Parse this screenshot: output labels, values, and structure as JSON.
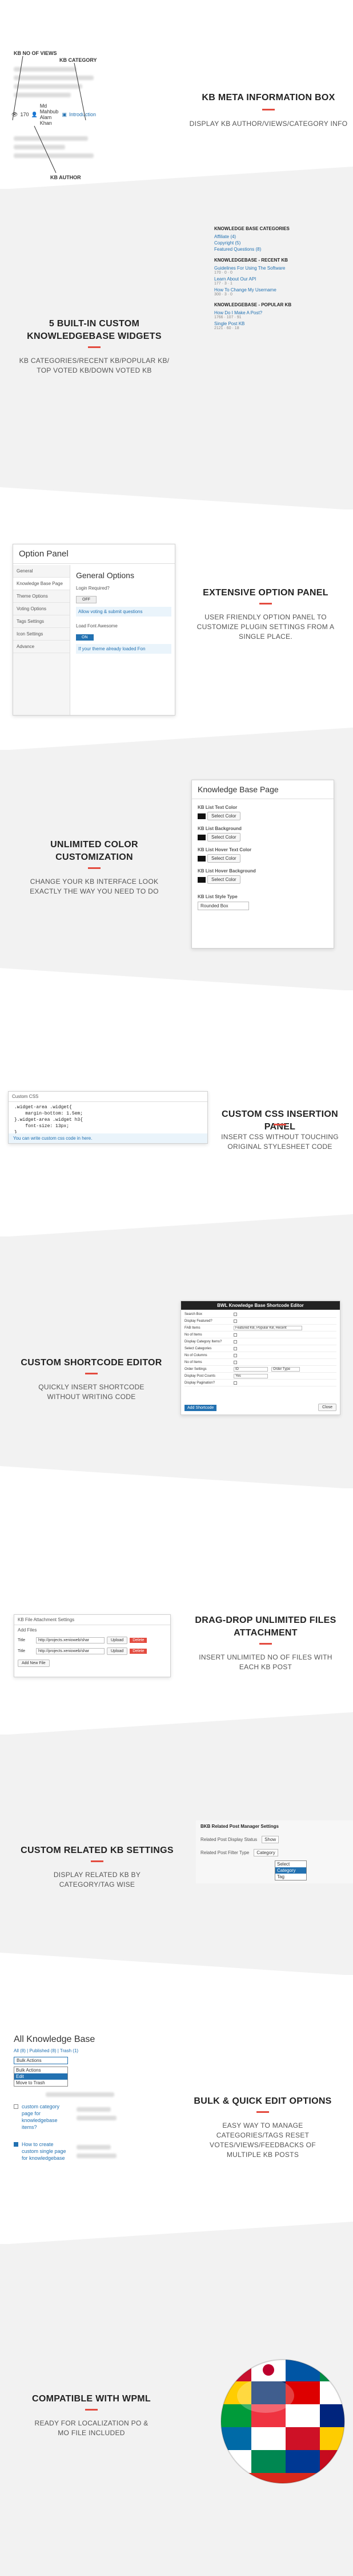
{
  "sections": {
    "meta": {
      "title": "KB META INFORMATION BOX",
      "desc": "DISPLAY KB AUTHOR/VIEWS/CATEGORY INFO",
      "callouts": {
        "views": "KB NO OF VIEWS",
        "category": "KB CATEGORY",
        "author": "KB AUTHOR"
      },
      "info_row": {
        "views": "170",
        "author": "Md Mahbub Alam Khan",
        "category": "Introduction"
      }
    },
    "widgets": {
      "title": "5 BUILT-IN CUSTOM KNOWLEDGEBASE WIDGETS",
      "desc": "KB CATEGORIES/RECENT KB/POPULAR KB/ TOP VOTED KB/DOWN VOTED KB",
      "panel": {
        "cat_heading": "KNOWLEDGE BASE CATEGORIES",
        "cat_items": [
          "Affiliate (4)",
          "Copyright (5)",
          "Featured Questions (8)"
        ],
        "recent_heading": "KNOWLEDGEBASE - RECENT KB",
        "recent_items": [
          {
            "title": "Guidelines For Using The Software",
            "meta": "170 · 0 · 0"
          },
          {
            "title": "Learn About Our API",
            "meta": "177 · 3 · 1"
          },
          {
            "title": "How To Change My Username",
            "meta": "300 · 3 · 0"
          }
        ],
        "popular_heading": "KNOWLEDGEBASE - POPULAR KB",
        "popular_items": [
          {
            "title": "How Do I Make A Post?",
            "meta": "1766 · 107 · 91"
          },
          {
            "title": "Single Post KB",
            "meta": "2121 · 60 · 18"
          }
        ]
      }
    },
    "options": {
      "title": "EXTENSIVE OPTION PANEL",
      "desc": "USER FRIENDLY OPTION PANEL TO CUSTOMIZE PLUGIN SETTINGS FROM A SINGLE PLACE.",
      "panel": {
        "header": "Option Panel",
        "menu": [
          "General",
          "Knowledge Base Page",
          "Theme Options",
          "Voting Options",
          "Tags Settings",
          "Icon Settings",
          "Advance"
        ],
        "main_title": "General Options",
        "login_label": "Login Required?",
        "login_toggle": "OFF",
        "login_hint": "Allow voting & submit questions",
        "load_label": "Load Font Awesome",
        "load_toggle": "ON",
        "load_hint": "If your theme already loaded Fon"
      }
    },
    "colors": {
      "title": "UNLIMITED COLOR CUSTOMIZATION",
      "desc": "CHANGE YOUR KB INTERFACE LOOK EXACTLY THE WAY YOU NEED TO DO",
      "panel": {
        "header": "Knowledge Base Page",
        "fields": [
          {
            "label": "KB List Text Color",
            "button": "Select Color"
          },
          {
            "label": "KB List Background",
            "button": "Select Color"
          },
          {
            "label": "KB List Hover Text Color",
            "button": "Select Color"
          },
          {
            "label": "KB List Hover Background",
            "button": "Select Color"
          }
        ],
        "style_label": "KB List Style Type",
        "style_value": "Rounded Box"
      }
    },
    "css": {
      "title": "CUSTOM CSS INSERTION PANEL",
      "desc": "INSERT CSS WITHOUT TOUCHING ORIGINAL STYLESHEET CODE",
      "panel": {
        "header": "Custom CSS",
        "lines": [
          ".widget-area .widget{",
          "    margin-bottom: 1.5em;",
          "}.widget-area .widget h3{",
          "    font-size: 13px;",
          "}"
        ],
        "hint": "You can write custom css code in here."
      }
    },
    "shortcode": {
      "title": "CUSTOM SHORTCODE EDITOR",
      "desc": "QUICKLY INSERT SHORTCODE WITHOUT WRITING CODE",
      "panel": {
        "header": "BWL Knowledge Base Shortcode Editor",
        "rows": [
          "Search Box",
          "Display Featured?",
          "FAB Items",
          "No of Items",
          "Display Category Items?",
          "Select Categories",
          "No of Columns",
          "No of Items",
          "Order Settings",
          "Display Post Counts",
          "Display Pagination?"
        ],
        "fab_value": "Featured KB, Popular KB, Recent",
        "order_value": "ID",
        "order_type": "Order Type",
        "counts_value": "Yes",
        "insert_label": "Add Shortcode",
        "close_label": "Close"
      }
    },
    "files": {
      "title": "DRAG-DROP UNLIMITED FILES ATTACHMENT",
      "desc": "INSERT UNLIMITED NO OF FILES WITH EACH KB POST",
      "panel": {
        "header": "KB File Attachment Settings",
        "add_label": "Add Files",
        "row_label": "Title",
        "url_value": "http://projects.xenioweb/shar",
        "upload_label": "Upload",
        "remove_label": "Delete",
        "add_button": "Add New File"
      }
    },
    "related": {
      "title": "CUSTOM RELATED KB SETTINGS",
      "desc": "DISPLAY RELATED KB BY CATEGORY/TAG WISE",
      "panel": {
        "header": "BKB Related Post Manager Settings",
        "status_label": "Related Post Display Status",
        "status_value": "Show",
        "filter_label": "Related Post Filter Type",
        "filter_value": "Category",
        "options": [
          "Select",
          "Category",
          "Tag"
        ]
      }
    },
    "bulk": {
      "title": "BULK & QUICK EDIT OPTIONS",
      "desc": "EASY WAY TO MANAGE CATEGORIES/TAGS RESET VOTES/VIEWS/FEEDBACKS OF MULTIPLE KB POSTS",
      "panel": {
        "header": "All Knowledge Base",
        "filters": "All (8) | Published (8) | Trash (1)",
        "select_value": "Bulk Actions",
        "options": [
          "Bulk Actions",
          "Edit",
          "Move to Trash"
        ],
        "item1": "custom category page for knowledgebase items?",
        "item2": "How to create custom single page for knowledgebase"
      }
    },
    "wpml": {
      "title": "COMPATIBLE WITH WPML",
      "desc": "READY FOR LOCALIZATION PO & MO FILE INCLUDED"
    }
  },
  "colors": {
    "accent": "#e34b3f",
    "link": "#2271b1",
    "band": "#f2f2f2",
    "dark": "#222222"
  }
}
